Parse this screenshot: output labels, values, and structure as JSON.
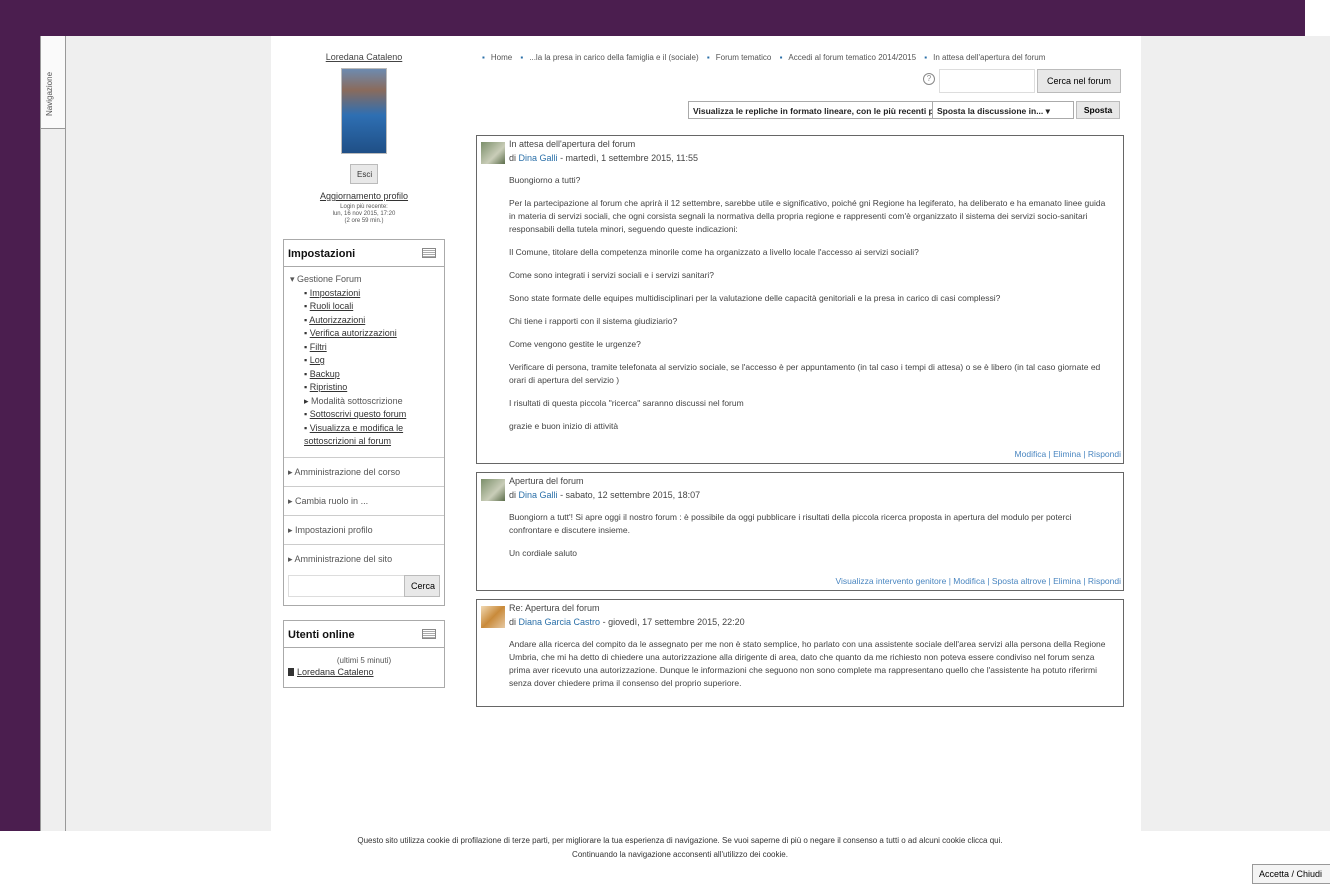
{
  "nav": {
    "tab_label": "Navigazione"
  },
  "profile": {
    "name": "Loredana Cataleno",
    "logout": "Esci",
    "update_profile": "Aggiornamento profilo",
    "last_login_label": "Login più recente:",
    "last_login_date": "lun, 16 nov 2015, 17:20",
    "last_login_ago": "(2 ore 59 min.)"
  },
  "settings": {
    "title": "Impostazioni",
    "group": "Gestione Forum",
    "items": [
      {
        "label": "Impostazioni",
        "link": true
      },
      {
        "label": "Ruoli locali",
        "link": true
      },
      {
        "label": "Autorizzazioni",
        "link": true
      },
      {
        "label": "Verifica autorizzazioni",
        "link": true
      },
      {
        "label": "Filtri",
        "link": true
      },
      {
        "label": "Log",
        "link": true
      },
      {
        "label": "Backup",
        "link": true
      },
      {
        "label": "Ripristino",
        "link": true
      },
      {
        "label": "Modalità sottoscrizione",
        "link": false
      },
      {
        "label": "Sottoscrivi questo forum",
        "link": true
      },
      {
        "label": "Visualizza e modifica le sottoscrizioni al forum",
        "link": true
      }
    ],
    "sections": [
      "Amministrazione del corso",
      "Cambia ruolo in ...",
      "Impostazioni profilo",
      "Amministrazione del sito"
    ],
    "search_button": "Cerca"
  },
  "online": {
    "title": "Utenti online",
    "period": "(ultimi 5 minuti)",
    "user": "Loredana Cataleno"
  },
  "breadcrumb": [
    "Home",
    "...la la presa in carico della famiglia e il (sociale)",
    "Forum tematico",
    "Accedi al forum tematico 2014/2015",
    "In attesa dell'apertura del forum"
  ],
  "forum_search": {
    "button": "Cerca nel forum"
  },
  "display": {
    "mode": "Visualizza le repliche in formato lineare, con le più recenti per prime",
    "move": "Sposta la discussione in...",
    "move_button": "Sposta"
  },
  "posts": [
    {
      "subject": "In attesa dell'apertura del forum",
      "by": "di",
      "author": "Dina Galli",
      "date": "- martedì, 1 settembre 2015, 11:55",
      "paragraphs": [
        "Buongiorno a tutti?",
        "Per la partecipazione al forum che aprirà il 12 settembre, sarebbe  utile e significativo, poiché gni Regione ha legiferato, ha deliberato e ha emanato linee guida in materia di servizi sociali, che ogni corsista segnali la normativa della propria regione  e rappresenti com'è  organizzato il sistema dei servizi socio-sanitari responsabili della  tutela minori, seguendo queste indicazioni:",
        "Il Comune, titolare della competenza minorile  come ha organizzato a livello locale  l'accesso ai servizi sociali?",
        "Come sono integrati i servizi sociali e i servizi sanitari?",
        "Sono state formate delle equipes multidisciplinari  per la valutazione delle capacità genitoriali  e la presa in carico di casi complessi?",
        "Chi tiene i rapporti con il sistema giudiziario?",
        "Come vengono gestite le urgenze?",
        "Verificare di persona, tramite telefonata al servizio sociale, se l'accesso è per appuntamento (in tal caso i tempi di attesa) o se è libero (in tal caso giornate ed orari di apertura del servizio )",
        "I risultati di questa piccola \"ricerca\" saranno discussi nel forum",
        "grazie e buon inizio di attività"
      ],
      "actions": "Modifica | Elimina | Rispondi"
    },
    {
      "subject": "Apertura del forum",
      "by": "di",
      "author": "Dina Galli",
      "date": "- sabato, 12 settembre 2015, 18:07",
      "paragraphs": [
        "Buongiorn a tutt'! Si apre oggi il nostro forum : è possibile da oggi pubblicare i risultati della piccola ricerca proposta in apertura del modulo per poterci confrontare e discutere insieme.",
        "Un cordiale saluto"
      ],
      "actions": "Visualizza intervento genitore | Modifica | Sposta altrove | Elimina | Rispondi"
    },
    {
      "subject": "Re: Apertura del forum",
      "by": "di",
      "author": "Diana Garcia Castro",
      "date": "- giovedì, 17 settembre 2015, 22:20",
      "paragraphs": [
        "Andare alla ricerca del compito da le assegnato per me non è stato semplice, ho parlato con una assistente sociale dell'area servizi alla persona della Regione Umbria, che mi ha detto di chiedere una autorizzazione alla dirigente di area, dato che quanto da me richiesto non poteva essere condiviso nel  forum senza prima aver ricevuto una autorizzazione. Dunque le informazioni che seguono non sono complete ma rappresentano quello che l'assistente ha potuto riferirmi senza dover chiedere prima il consenso del proprio superiore."
      ],
      "actions": ""
    }
  ],
  "cookie": {
    "line1": "Questo sito utilizza cookie di profilazione di terze parti, per migliorare la tua esperienza di navigazione. Se vuoi saperne di più o negare il consenso a tutti o ad alcuni cookie clicca qui.",
    "line2": "Continuando la navigazione acconsenti all'utilizzo dei cookie.",
    "accept": "Accetta / Chiudi"
  }
}
